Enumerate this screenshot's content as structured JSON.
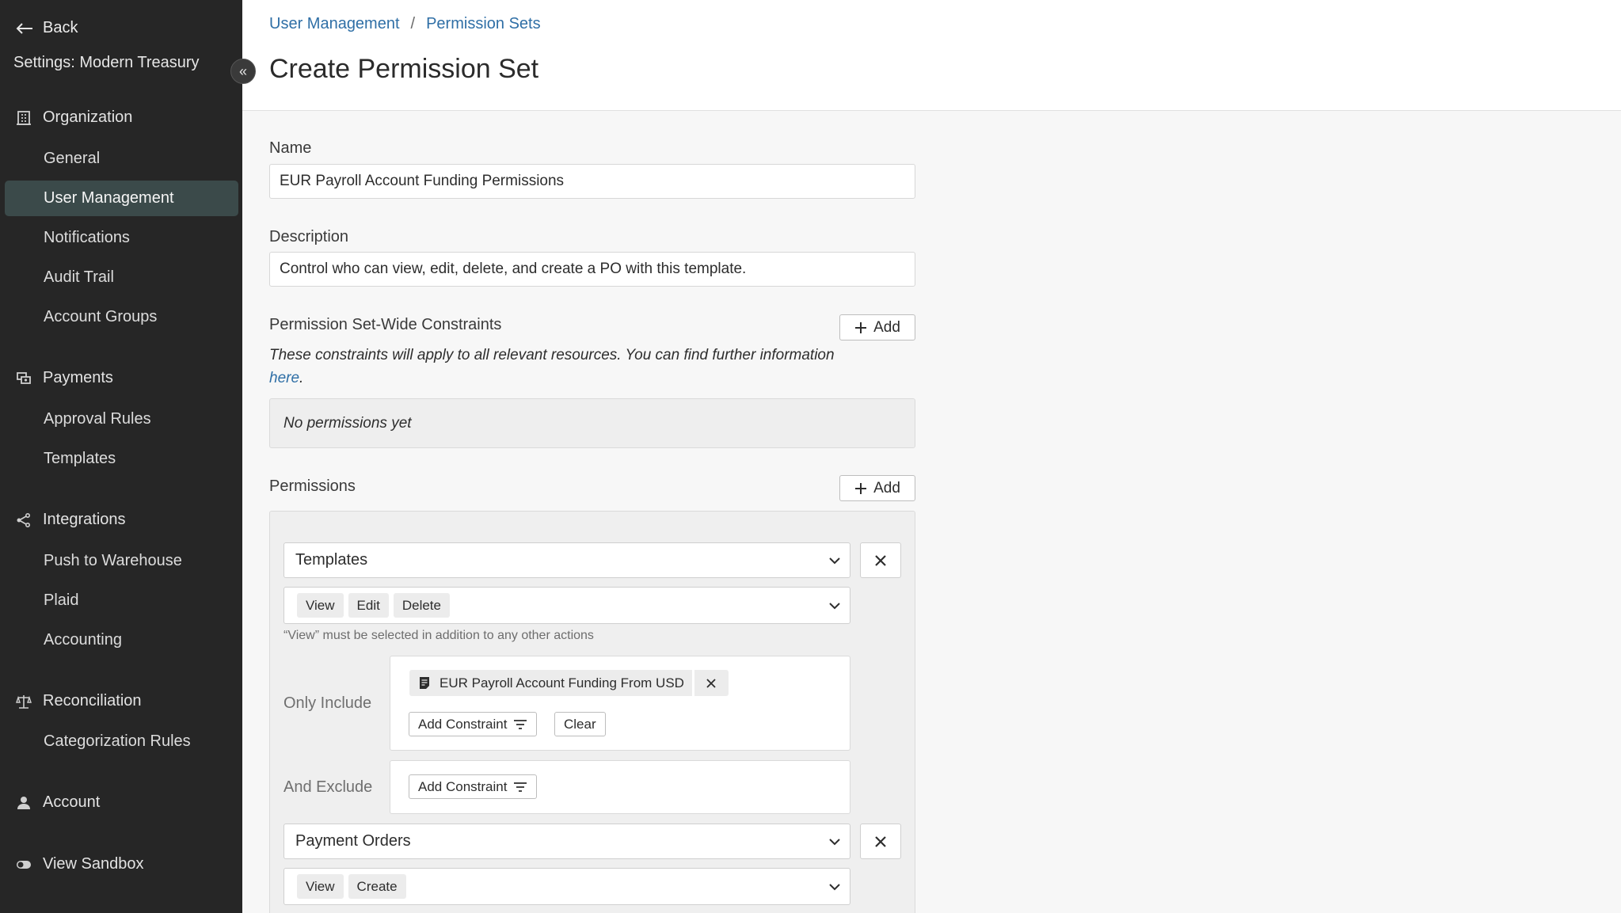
{
  "sidebar": {
    "back_label": "Back",
    "org_title": "Settings: Modern Treasury",
    "collapse_glyph": "«",
    "sections": [
      {
        "label": "Organization",
        "icon": "building-icon"
      },
      {
        "label": "Payments",
        "icon": "payments-icon"
      },
      {
        "label": "Integrations",
        "icon": "integrations-icon"
      },
      {
        "label": "Reconciliation",
        "icon": "scale-icon"
      },
      {
        "label": "Account",
        "icon": "user-icon"
      },
      {
        "label": "View Sandbox",
        "icon": "toggle-icon"
      }
    ],
    "items": {
      "organization": [
        "General",
        "User Management",
        "Notifications",
        "Audit Trail",
        "Account Groups"
      ],
      "payments": [
        "Approval Rules",
        "Templates"
      ],
      "integrations": [
        "Push to Warehouse",
        "Plaid",
        "Accounting"
      ],
      "reconciliation": [
        "Categorization Rules"
      ]
    },
    "active_item": "User Management"
  },
  "header": {
    "breadcrumb": [
      "User Management",
      "Permission Sets"
    ],
    "separator": "/",
    "title": "Create Permission Set"
  },
  "form": {
    "name_label": "Name",
    "name_value": "EUR Payroll Account Funding Permissions",
    "description_label": "Description",
    "description_value": "Control who can view, edit, delete, and create a PO with this template.",
    "constraints_label": "Permission Set-Wide Constraints",
    "add_label": "Add",
    "constraints_note": "These constraints will apply to all relevant resources. You can find further information ",
    "constraints_note_link": "here",
    "constraints_note_end": ".",
    "empty_text": "No permissions yet",
    "permissions_label": "Permissions"
  },
  "permissions": [
    {
      "resource": "Templates",
      "actions": [
        "View",
        "Edit",
        "Delete"
      ],
      "hint": "“View” must be selected in addition to any other actions",
      "only_include_label": "Only Include",
      "included_tag": "EUR Payroll Account Funding From USD",
      "add_constraint_label": "Add Constraint",
      "clear_label": "Clear",
      "and_exclude_label": "And Exclude"
    },
    {
      "resource": "Payment Orders",
      "actions": [
        "View",
        "Create"
      ]
    }
  ]
}
